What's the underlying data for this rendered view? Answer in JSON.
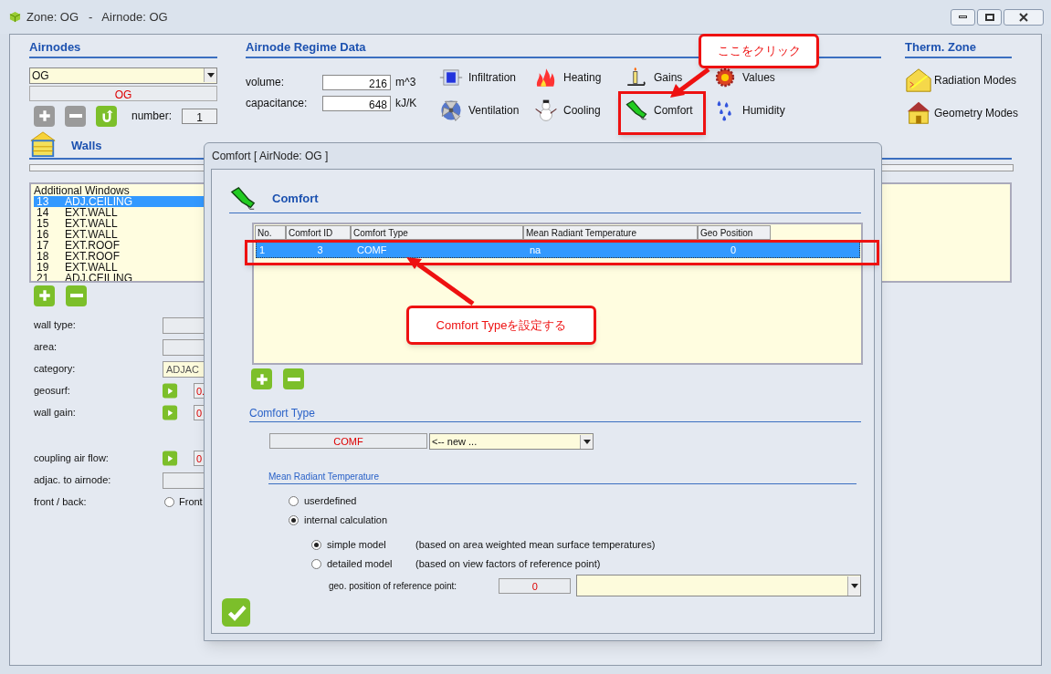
{
  "window": {
    "title": "Zone: OG   -   Airnode: OG"
  },
  "airnodes": {
    "heading": "Airnodes",
    "selected_airnode": "OG",
    "name": "OG",
    "buttons": [
      {
        "kind": "add",
        "disabled": true
      },
      {
        "kind": "remove",
        "disabled": true
      },
      {
        "kind": "reset",
        "disabled": false
      }
    ],
    "number_label": "number:",
    "number": "1"
  },
  "regime": {
    "heading": "Airnode Regime Data",
    "fields": [
      {
        "label": "volume:",
        "value": "216",
        "unit": "m^3"
      },
      {
        "label": "capacitance:",
        "value": "648",
        "unit": "kJ/K"
      }
    ],
    "tools": [
      {
        "label": "Infiltration"
      },
      {
        "label": "Heating"
      },
      {
        "label": "Gains"
      },
      {
        "label": "Values"
      },
      {
        "label": "Ventilation"
      },
      {
        "label": "Cooling"
      },
      {
        "label": "Comfort"
      },
      {
        "label": "Humidity"
      }
    ]
  },
  "therm_zone": {
    "heading": "Therm. Zone",
    "items": [
      {
        "label": "Radiation Modes"
      },
      {
        "label": "Geometry Modes"
      }
    ]
  },
  "walls": {
    "heading": "Walls",
    "group": "Additional Windows",
    "rows": [
      {
        "no": "13",
        "name": "ADJ.CEILING",
        "selected": true
      },
      {
        "no": "14",
        "name": "EXT.WALL",
        "selected": false
      },
      {
        "no": "15",
        "name": "EXT.WALL",
        "selected": false
      },
      {
        "no": "16",
        "name": "EXT.WALL",
        "selected": false
      },
      {
        "no": "17",
        "name": "EXT.ROOF",
        "selected": false
      },
      {
        "no": "18",
        "name": "EXT.ROOF",
        "selected": false
      },
      {
        "no": "19",
        "name": "EXT.WALL",
        "selected": false
      },
      {
        "no": "21",
        "name": "ADJ.CEILING",
        "selected": false
      }
    ],
    "properties": [
      {
        "label": "wall type:",
        "kind": "field"
      },
      {
        "label": "area:",
        "kind": "field"
      },
      {
        "label": "category:",
        "kind": "field",
        "value": "ADJAC"
      },
      {
        "label": "geosurf:",
        "kind": "play",
        "value": "0."
      },
      {
        "label": "wall gain:",
        "kind": "play",
        "value": "0"
      },
      {
        "label": "coupling air flow:",
        "kind": "play",
        "value": "0"
      },
      {
        "label": "adjac. to airnode:",
        "kind": "field"
      },
      {
        "label": "front / back:",
        "kind": "radio",
        "value": "Front",
        "selected": false
      }
    ]
  },
  "dialog": {
    "title": "Comfort [ AirNode: OG ]",
    "heading": "Comfort",
    "table": {
      "columns": [
        "No.",
        "Comfort ID",
        "Comfort Type",
        "Mean Radiant Temperature",
        "Geo Position"
      ],
      "rows": [
        {
          "cells": [
            "1",
            "3",
            "COMF",
            "na",
            "0"
          ],
          "selected": true
        }
      ]
    },
    "comfort_type": {
      "heading": "Comfort Type",
      "name": "COMF",
      "choice": "<-- new ..."
    },
    "mrt": {
      "heading": "Mean Radiant Temperature",
      "modes": [
        {
          "label": "userdefined",
          "selected": false
        },
        {
          "label": "internal calculation",
          "selected": true
        }
      ],
      "models": [
        {
          "label": "simple model",
          "note": "(based on area weighted mean surface temperatures)",
          "selected": true
        },
        {
          "label": "detailed model",
          "note": "(based on view factors of reference point)",
          "selected": false
        }
      ],
      "ref_label": "geo. position of reference point:",
      "ref_value": "0"
    }
  },
  "annotations": [
    {
      "text": "ここをクリック"
    },
    {
      "text": "Comfort Typeを設定する"
    }
  ]
}
